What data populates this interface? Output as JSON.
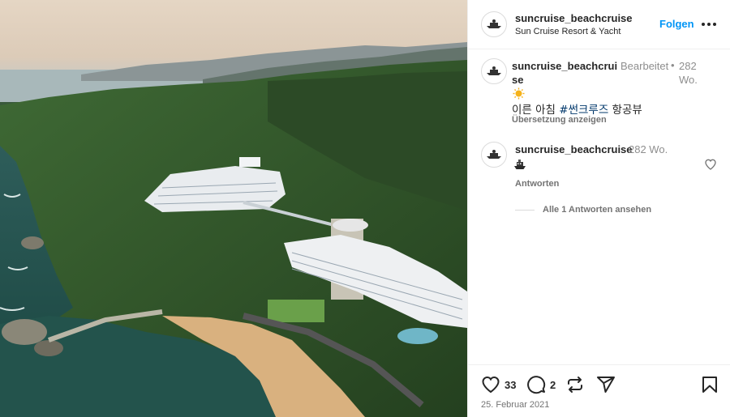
{
  "header": {
    "username": "suncruise_beachcruise",
    "subtitle": "Sun Cruise Resort & Yacht",
    "follow_label": "Folgen",
    "more_icon": "more-horizontal-icon"
  },
  "caption": {
    "username": "suncruise_beachcruise",
    "edited_label": "Bearbeitet",
    "separator": "•",
    "time": "282 Wo.",
    "emoji": "sun-emoji",
    "text_before": "이른 아침 ",
    "hashtag": "#썬크루즈",
    "text_after": " 항공뷰",
    "translate_label": "Übersetzung anzeigen"
  },
  "reply": {
    "username": "suncruise_beachcruise",
    "time": "282 Wo.",
    "emoji": "ship-emoji",
    "answer_label": "Antworten",
    "view_replies_label": "Alle 1 Antworten ansehen"
  },
  "actions": {
    "like_count": "33",
    "comment_count": "2",
    "date": "25. Februar 2021"
  },
  "colors": {
    "link_blue": "#0095f6",
    "hashtag": "#00376b",
    "muted": "#737373",
    "border": "#efefef"
  }
}
